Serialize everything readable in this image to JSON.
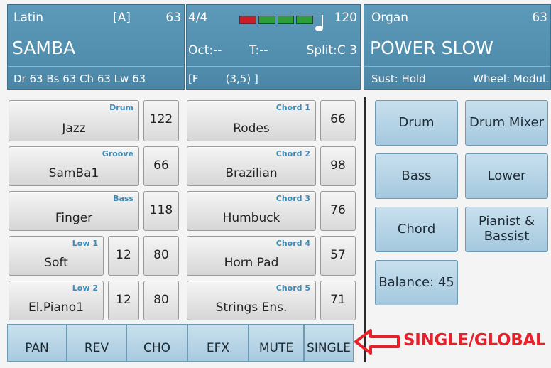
{
  "style_panel": {
    "category": "Latin",
    "variation": "[A]",
    "number": "63",
    "name": "SAMBA",
    "volumes": "Dr 63  Bs 63  Ch 63  Lw 63"
  },
  "status_panel": {
    "time_signature": "4/4",
    "tempo": "120",
    "octave": "Oct:--",
    "transpose": "T:--",
    "split": "Split:C 3",
    "chord": "[F        (3,5) ]",
    "beat_colors": [
      "#c81d2a",
      "#2e9e3a",
      "#2e9e3a",
      "#2e9e3a"
    ]
  },
  "voice_panel": {
    "category": "Organ",
    "number": "63",
    "name": "POWER SLOW",
    "sustain": "Sust: Hold",
    "wheel": "Wheel: Modul."
  },
  "parts_left": [
    {
      "label": "Jazz",
      "tag": "Drum",
      "value": "122"
    },
    {
      "label": "SamBa1",
      "tag": "Groove",
      "value": "66"
    },
    {
      "label": "Finger",
      "tag": "Bass",
      "value": "118"
    },
    {
      "label": "Soft",
      "tag": "Low 1",
      "octave": "12",
      "value": "80"
    },
    {
      "label": "El.Piano1",
      "tag": "Low 2",
      "octave": "12",
      "value": "80"
    }
  ],
  "parts_mid": [
    {
      "label": "Rodes",
      "tag": "Chord 1",
      "value": "66"
    },
    {
      "label": "Brazilian",
      "tag": "Chord 2",
      "value": "98"
    },
    {
      "label": "Humbuck",
      "tag": "Chord 3",
      "value": "76"
    },
    {
      "label": "Horn Pad",
      "tag": "Chord 4",
      "value": "57"
    },
    {
      "label": "Strings Ens.",
      "tag": "Chord 5",
      "value": "71"
    }
  ],
  "right_buttons": {
    "drum": "Drum",
    "drum_mixer": "Drum Mixer",
    "bass": "Bass",
    "lower": "Lower",
    "chord": "Chord",
    "pianist_bassist": "Pianist & Bassist",
    "balance": "Balance: 45"
  },
  "tabs": [
    "PAN",
    "REV",
    "CHO",
    "EFX",
    "MUTE",
    "SINGLE"
  ],
  "annotation": "SINGLE/GLOBAL",
  "colors": {
    "header_blue": "#4f8cad",
    "tag_blue": "#3f8ab5",
    "annotation_red": "#e8202a"
  }
}
